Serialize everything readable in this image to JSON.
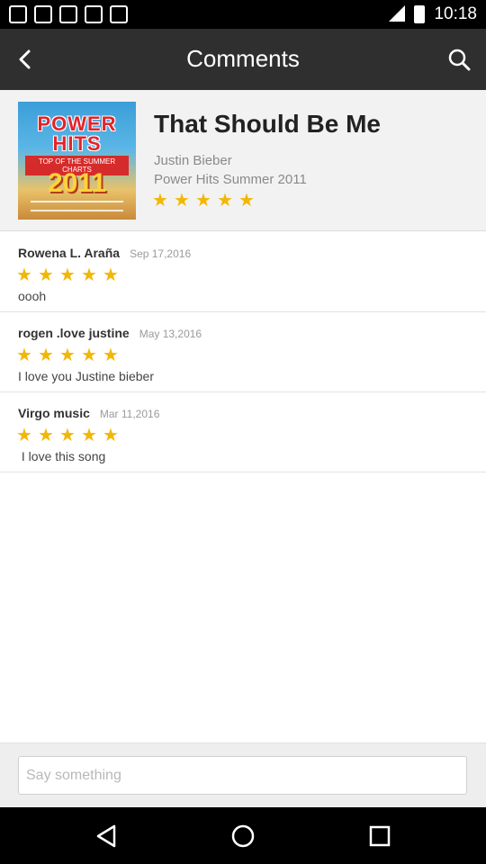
{
  "status_bar": {
    "time": "10:18",
    "icons": [
      "notification-icon",
      "notification-icon",
      "notification-icon",
      "notification-icon",
      "notification-icon",
      "signal-icon",
      "battery-icon"
    ]
  },
  "app_bar": {
    "title": "Comments",
    "back_icon": "back-chevron-icon",
    "search_icon": "search-icon",
    "background": "#2f2f2f"
  },
  "song": {
    "title": "That Should Be Me",
    "artist": "Justin Bieber",
    "album": "Power Hits Summer 2011",
    "rating": 5,
    "album_art": {
      "top_text": "POWER HITS",
      "sub_text": "TOP OF THE SUMMER CHARTS",
      "year_text": "2011"
    }
  },
  "comments": [
    {
      "name": "Rowena L. Araña",
      "date": "Sep 17,2016",
      "rating": 5,
      "text": "oooh"
    },
    {
      "name": "rogen .love justine",
      "date": "May 13,2016",
      "rating": 5,
      "text": "I love you Justine bieber"
    },
    {
      "name": "Virgo music",
      "date": "Mar 11,2016",
      "rating": 5,
      "text": " I love this song"
    }
  ],
  "input": {
    "placeholder": "Say something",
    "value": ""
  },
  "nav_bar": {
    "back_icon": "nav-back-icon",
    "home_icon": "nav-home-icon",
    "recents_icon": "nav-recents-icon"
  },
  "colors": {
    "star": "#f2b705",
    "header_bg": "#f2f2f2"
  }
}
